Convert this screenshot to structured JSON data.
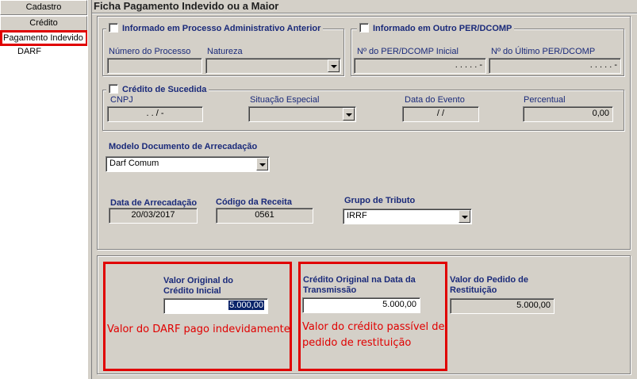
{
  "nav": {
    "cadastro": "Cadastro",
    "credito": "Crédito",
    "selected_item": "Pagamento Indevido o",
    "darf_item": "DARF"
  },
  "page": {
    "title": "Ficha Pagamento Indevido ou a Maior"
  },
  "processo_adm": {
    "legend": "Informado em Processo Administrativo Anterior",
    "numero_label": "Número do Processo",
    "natureza_label": "Natureza",
    "numero_value": "",
    "natureza_value": ""
  },
  "outro_perdcomp": {
    "legend": "Informado em Outro PER/DCOMP",
    "inicial_label": "Nº do PER/DCOMP Inicial",
    "ultimo_label": "Nº do Último PER/DCOMP",
    "inicial_value": ". . . . . -",
    "ultimo_value": ". . . . . -"
  },
  "sucedida": {
    "legend": "Crédito de Sucedida",
    "cnpj_label": "CNPJ",
    "cnpj_value": ". . / -",
    "situacao_label": "Situação Especial",
    "situacao_value": "",
    "data_evento_label": "Data do Evento",
    "data_evento_value": "/ /",
    "percentual_label": "Percentual",
    "percentual_value": "0,00"
  },
  "modelo": {
    "label": "Modelo Documento de Arrecadação",
    "value": "Darf Comum"
  },
  "arrecadacao": {
    "data_label": "Data de Arrecadação",
    "data_value": "20/03/2017",
    "codigo_label": "Código da Receita",
    "codigo_value": "0561",
    "grupo_label": "Grupo de Tributo",
    "grupo_value": "IRRF"
  },
  "valores": {
    "original_label_1": "Valor Original do",
    "original_label_2": "Crédito Inicial",
    "original_value": "5.000,00",
    "transmissao_label_1": "Crédito Original na Data da",
    "transmissao_label_2": "Transmissão",
    "transmissao_value": "5.000,00",
    "pedido_label_1": "Valor do Pedido de",
    "pedido_label_2": "Restituição",
    "pedido_value": "5.000,00"
  },
  "annotations": {
    "darf_note": "Valor do DARF pago indevidamente",
    "credito_note_1": "Valor do crédito passível de",
    "credito_note_2": "pedido de restituição",
    "color": "#e00000"
  }
}
